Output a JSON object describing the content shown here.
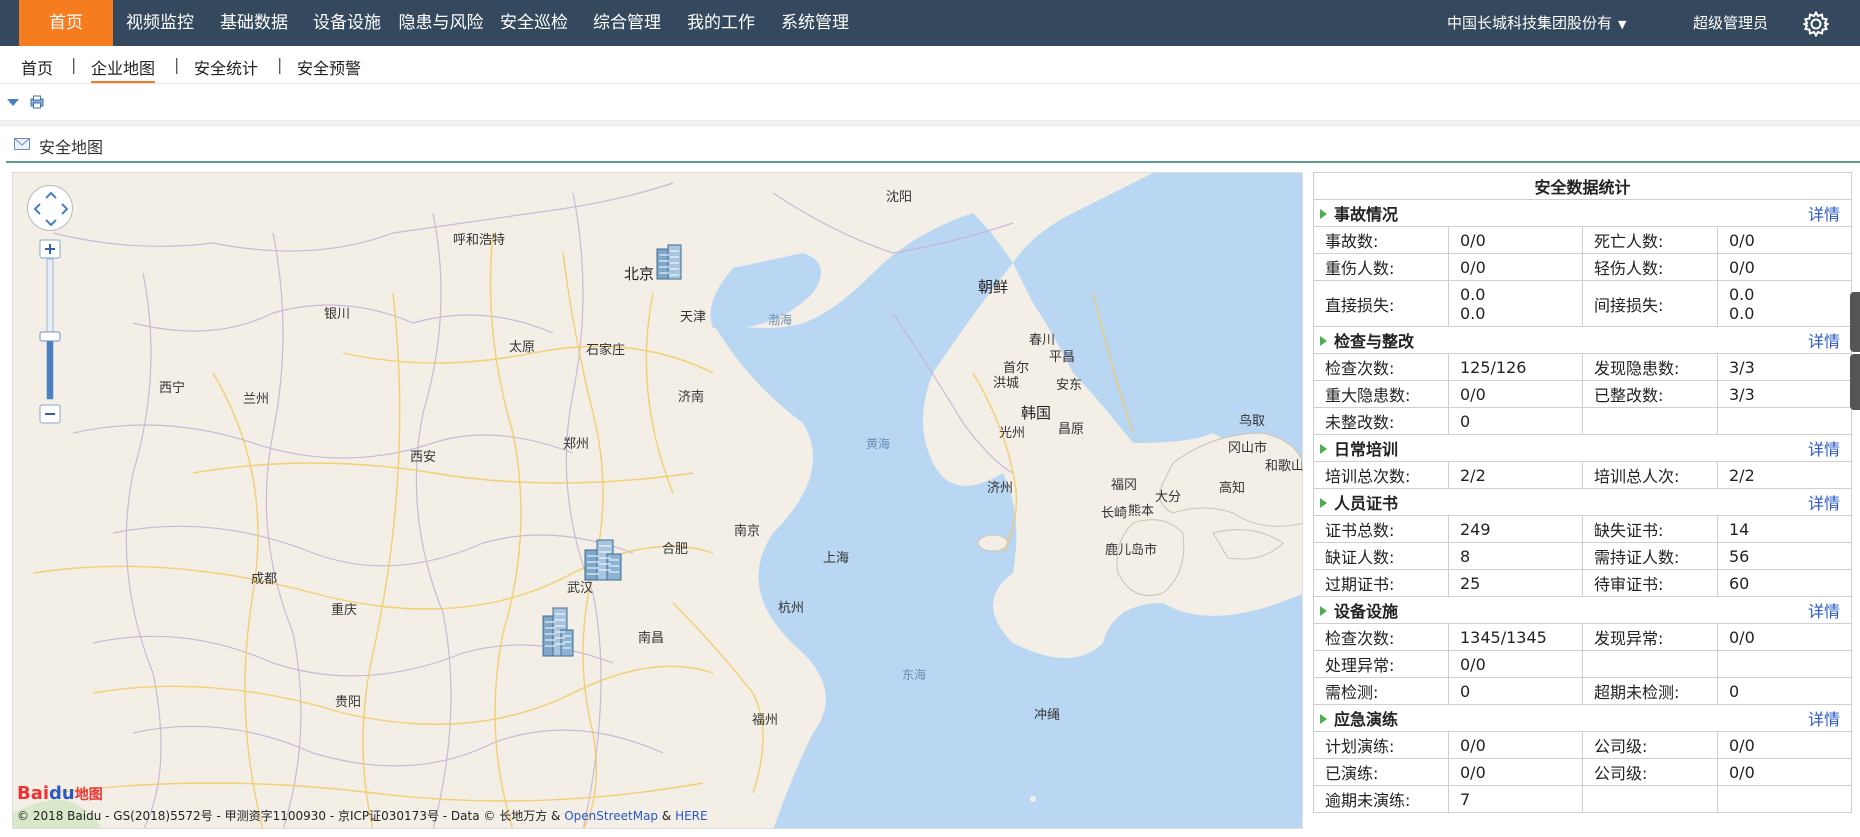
{
  "topnav": {
    "items": [
      {
        "label": "首页",
        "active": true
      },
      {
        "label": "视频监控"
      },
      {
        "label": "基础数据"
      },
      {
        "label": "设备设施"
      },
      {
        "label": "隐患与风险"
      },
      {
        "label": "安全巡检"
      },
      {
        "label": "综合管理"
      },
      {
        "label": "我的工作"
      },
      {
        "label": "系统管理"
      }
    ],
    "company": "中国长城科技集团股份有",
    "user": "超级管理员",
    "settings_icon": "gear-icon",
    "active_color": "#f57c1f",
    "bar_color": "#34495e"
  },
  "subnav": {
    "tabs": [
      {
        "label": "首页"
      },
      {
        "label": "企业地图",
        "active": true
      },
      {
        "label": "安全统计"
      },
      {
        "label": "安全预警"
      }
    ],
    "separator": "|"
  },
  "panel": {
    "title": "安全地图"
  },
  "map": {
    "cities": [
      "沈阳",
      "呼和浩特",
      "北京",
      "天津",
      "银川",
      "太原",
      "石家庄",
      "西宁",
      "兰州",
      "济南",
      "郑州",
      "西安",
      "南京",
      "合肥",
      "上海",
      "成都",
      "武汉",
      "重庆",
      "杭州",
      "南昌",
      "贵阳",
      "福州",
      "朝鲜",
      "首尔",
      "春川",
      "平昌",
      "洪城",
      "安东",
      "韩国",
      "光州",
      "昌原",
      "济州",
      "福冈",
      "大分",
      "长崎",
      "熊本",
      "鹿儿岛市",
      "鸟取",
      "冈山市",
      "和歌山",
      "高知",
      "冲绳"
    ],
    "seas": [
      "渤海",
      "黄海",
      "东海"
    ],
    "copyright": "© 2018 Baidu - GS(2018)5572号 - 甲测资字1100930 - 京ICP证030173号 - Data © 长地万方 &",
    "osm": "OpenStreetMap",
    "amp": "&",
    "here": "HERE",
    "logo": {
      "bai": "Bai",
      "du": "du",
      "ditu": "地图"
    }
  },
  "stats": {
    "title": "安全数据统计",
    "more": "详情",
    "sections": {
      "accident": {
        "name": "事故情况",
        "rows": [
          [
            "事故数:",
            "0/0",
            "死亡人数:",
            "0/0"
          ],
          [
            "重伤人数:",
            "0/0",
            "轻伤人数:",
            "0/0"
          ]
        ],
        "loss": {
          "direct_label": "直接损失:",
          "direct_1": "0.0",
          "direct_2": "0.0",
          "indirect_label": "间接损失:",
          "indirect_1": "0.0",
          "indirect_2": "0.0"
        }
      },
      "inspection": {
        "name": "检查与整改",
        "rows": [
          [
            "检查次数:",
            "125/126",
            "发现隐患数:",
            "3/3"
          ],
          [
            "重大隐患数:",
            "0/0",
            "已整改数:",
            "3/3"
          ],
          [
            "未整改数:",
            "0",
            "",
            ""
          ]
        ]
      },
      "training": {
        "name": "日常培训",
        "rows": [
          [
            "培训总次数:",
            "2/2",
            "培训总人次:",
            "2/2"
          ]
        ]
      },
      "certificate": {
        "name": "人员证书",
        "rows": [
          [
            "证书总数:",
            "249",
            "缺失证书:",
            "14"
          ],
          [
            "缺证人数:",
            "8",
            "需持证人数:",
            "56"
          ],
          [
            "过期证书:",
            "25",
            "待审证书:",
            "60"
          ]
        ]
      },
      "equipment": {
        "name": "设备设施",
        "rows": [
          [
            "检查次数:",
            "1345/1345",
            "发现异常:",
            "0/0"
          ],
          [
            "处理异常:",
            "0/0",
            "",
            ""
          ],
          [
            "需检测:",
            "0",
            "超期未检测:",
            "0"
          ]
        ]
      },
      "drill": {
        "name": "应急演练",
        "rows": [
          [
            "计划演练:",
            "0/0",
            "公司级:",
            "0/0"
          ],
          [
            "已演练:",
            "0/0",
            "公司级:",
            "0/0"
          ],
          [
            "逾期未演练:",
            "7",
            "",
            ""
          ]
        ]
      }
    }
  }
}
